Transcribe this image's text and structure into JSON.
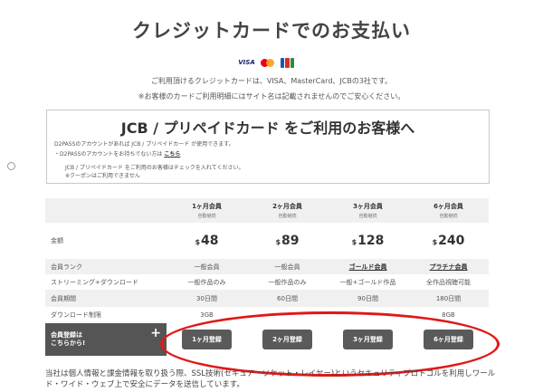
{
  "page": {
    "title": "クレジットカードでのお支払い",
    "subtitle1": "ご利用頂けるクレジットカードは、VISA、MasterCard、JCBの3社です。",
    "subtitle2": "※お客様のカードご利用明細にはサイト名は記載されませんのでご安心ください。"
  },
  "cards": {
    "visa": "VISA",
    "icons": [
      "visa-icon",
      "mastercard-icon",
      "jcb-icon"
    ]
  },
  "notice": {
    "title": "JCB / プリペイドカード をご利用のお客様へ",
    "line1": "D2PASSのアカウントがあれば JCB / プリペイドカード が使用できます。",
    "line2_prefix": "・D2PASSのアカウントをお持ちでない方は",
    "line2_link": "こちら",
    "checkbox_label": "JCB / プリペイドカード をご利用のお客様はチェックを入れてください。",
    "checkbox_note": "※クーポンはご利用できません"
  },
  "plans": [
    {
      "name": "1ヶ月会員",
      "auto": "自動継続",
      "price": "48",
      "rank": "一般会員",
      "rank_underline": false,
      "streaming": "一般作品のみ",
      "period": "30日間",
      "download": "3GB",
      "button": "1ヶ月登録"
    },
    {
      "name": "2ヶ月会員",
      "auto": "自動継続",
      "price": "89",
      "rank": "一般会員",
      "rank_underline": false,
      "streaming": "一般作品のみ",
      "period": "60日間",
      "download": "",
      "button": "2ヶ月登録"
    },
    {
      "name": "3ヶ月会員",
      "auto": "自動継続",
      "price": "128",
      "rank": "ゴールド会員",
      "rank_underline": true,
      "streaming": "一般+ゴールド作品",
      "period": "90日間",
      "download": "",
      "button": "3ヶ月登録"
    },
    {
      "name": "6ヶ月会員",
      "auto": "自動継続",
      "price": "240",
      "rank": "プラチナ会員",
      "rank_underline": true,
      "streaming": "全作品視聴可能",
      "period": "180日間",
      "download": "8GB",
      "button": "6ヶ月登録"
    }
  ],
  "labels": {
    "amount": "金額",
    "rank": "会員ランク",
    "streaming": "ストリーミング+ダウンロード",
    "period": "会員期間",
    "download": "ダウンロード制限",
    "register_line1": "会員登録は",
    "register_line2": "こちらから!",
    "currency": "$",
    "plus": "+"
  },
  "footer": {
    "text": "当社は個人情報と課金情報を取り扱う際、SSL技術(セキュア・ソケット・レイヤー)というセキュリティプロトコルを利用しワールド・ワイド・ウェブ上で安全にデータを送信しています。"
  },
  "colors": {
    "highlight": "#e01818",
    "button": "#5a5a5a",
    "row_alt": "#f0f0f0"
  }
}
